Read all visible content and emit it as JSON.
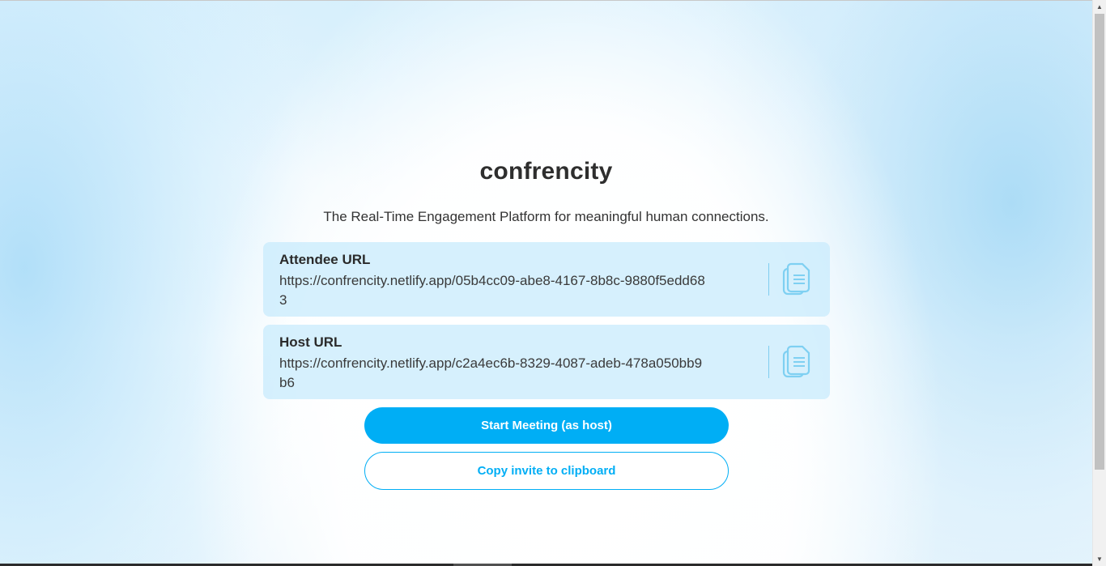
{
  "app": {
    "title": "confrencity",
    "tagline": "The Real-Time Engagement Platform for meaningful human connections."
  },
  "attendee": {
    "label": "Attendee URL",
    "url": "https://confrencity.netlify.app/05b4cc09-abe8-4167-8b8c-9880f5edd683",
    "copy_icon": "copy-icon"
  },
  "host": {
    "label": "Host URL",
    "url": "https://confrencity.netlify.app/c2a4ec6b-8329-4087-adeb-478a050bb9b6",
    "copy_icon": "copy-icon"
  },
  "actions": {
    "start_meeting": "Start Meeting (as host)",
    "copy_invite": "Copy invite to clipboard"
  },
  "colors": {
    "accent": "#00aef5",
    "card_bg": "#c8ebfc",
    "text": "#2e2e2e"
  }
}
